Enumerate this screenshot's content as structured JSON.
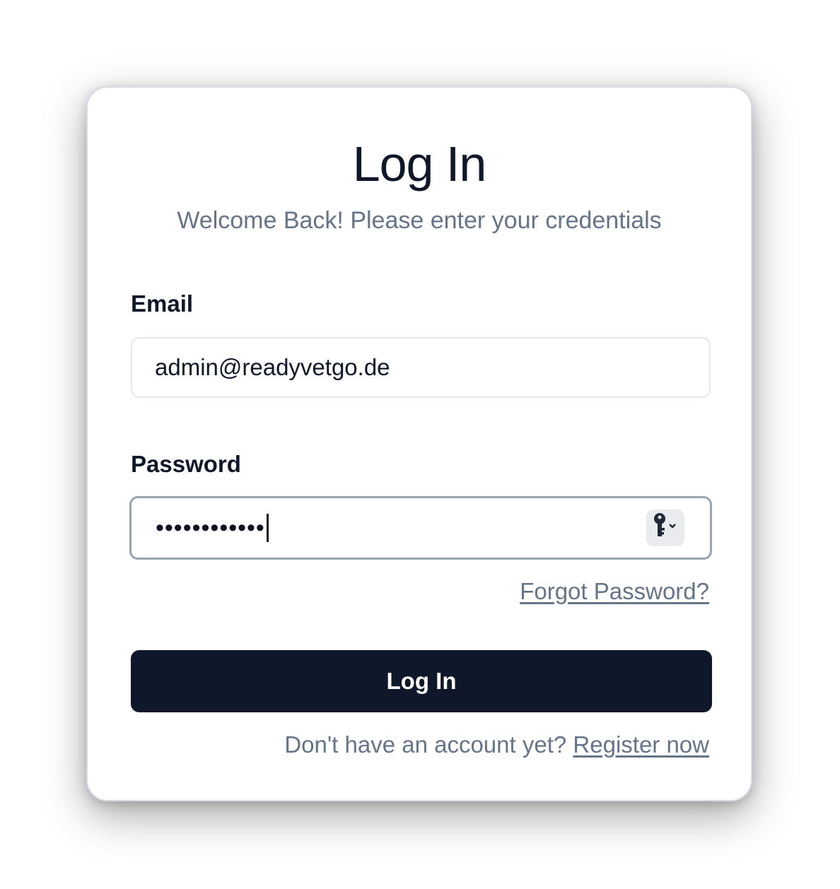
{
  "card": {
    "title": "Log In",
    "subtitle": "Welcome Back! Please enter your credentials"
  },
  "email": {
    "label": "Email",
    "value": "admin@readyvetgo.de"
  },
  "password": {
    "label": "Password",
    "masked_value": "••••••••••••",
    "autofill_icon": "key-icon"
  },
  "forgot_password": "Forgot Password?",
  "login_button": "Log In",
  "register": {
    "prompt": "Don't have an account yet?",
    "link": "Register now"
  },
  "colors": {
    "primary": "#0f172a",
    "muted_text": "#64748b",
    "border": "#e2e8f0"
  }
}
